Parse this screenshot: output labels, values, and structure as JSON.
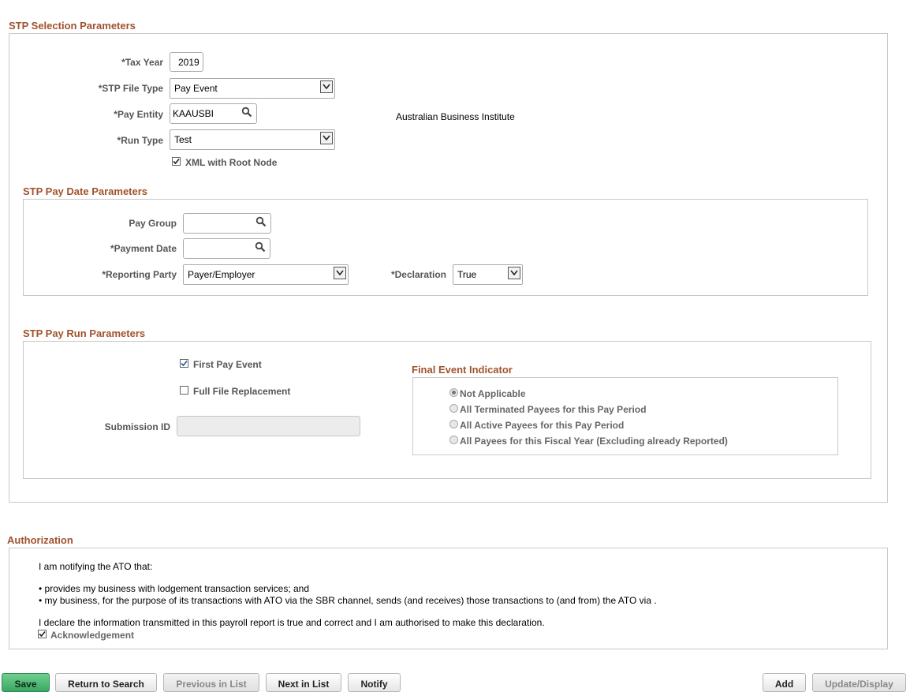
{
  "selection": {
    "title": "STP Selection Parameters",
    "tax_year_label": "*Tax Year",
    "tax_year_value": "2019",
    "file_type_label": "*STP File Type",
    "file_type_value": "Pay Event",
    "pay_entity_label": "*Pay Entity",
    "pay_entity_value": "KAAUSBI",
    "pay_entity_desc": "Australian Business Institute",
    "run_type_label": "*Run Type",
    "run_type_value": "Test",
    "xml_root_label": "XML with Root Node",
    "xml_root_checked": true
  },
  "pay_date": {
    "title": "STP Pay Date Parameters",
    "pay_group_label": "Pay Group",
    "pay_group_value": "",
    "payment_date_label": "*Payment Date",
    "payment_date_value": "",
    "reporting_party_label": "*Reporting Party",
    "reporting_party_value": "Payer/Employer",
    "declaration_label": "*Declaration",
    "declaration_value": "True"
  },
  "pay_run": {
    "title": "STP Pay Run Parameters",
    "first_pay_event_label": "First Pay Event",
    "first_pay_event_checked": true,
    "full_file_label": "Full File Replacement",
    "full_file_checked": false,
    "submission_id_label": "Submission ID",
    "submission_id_value": "",
    "final_event": {
      "title": "Final Event Indicator",
      "options": [
        "Not Applicable",
        "All Terminated Payees for this Pay Period",
        "All Active Payees for this Pay Period",
        "All Payees for this Fiscal Year (Excluding already Reported)"
      ],
      "selected": "Not Applicable"
    }
  },
  "authorization": {
    "title": "Authorization",
    "line1": "I am notifying the ATO that:",
    "bullet1": "• provides my business with lodgement transaction services; and",
    "bullet2": "• my business, for the purpose of its transactions with ATO via the SBR channel, sends (and receives) those transactions to (and from) the ATO via .",
    "declaration": "I declare the information transmitted in this payroll report is true and correct and I am authorised to make this declaration.",
    "ack_label": "Acknowledgement",
    "ack_checked": true
  },
  "toolbar": {
    "save": "Save",
    "return_to_search": "Return to Search",
    "previous_in_list": "Previous in List",
    "next_in_list": "Next in List",
    "notify": "Notify",
    "add": "Add",
    "update_display": "Update/Display"
  }
}
